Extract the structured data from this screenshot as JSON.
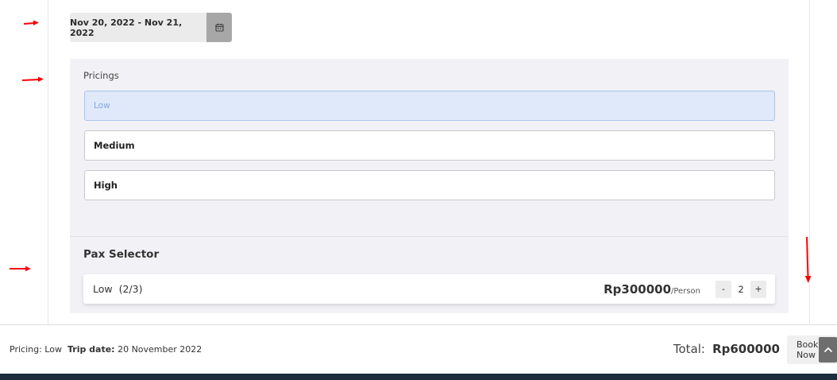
{
  "date_range": {
    "text": "Nov 20, 2022 - Nov 21, 2022",
    "icon": "calendar-icon"
  },
  "pricings": {
    "label": "Pricings",
    "options": [
      {
        "label": "Low",
        "selected": true
      },
      {
        "label": "Medium",
        "selected": false
      },
      {
        "label": "High",
        "selected": false
      }
    ]
  },
  "pax": {
    "title": "Pax Selector",
    "row": {
      "name": "Low",
      "count": "(2/3)",
      "price": "Rp300000",
      "unit": "/Person",
      "minus": "-",
      "value": "2",
      "plus": "+"
    }
  },
  "footer": {
    "pricing_label": "Pricing:",
    "pricing_value": "Low",
    "trip_label": "Trip date:",
    "trip_value": "20 November 2022",
    "total_label": "Total:",
    "total_value": "Rp600000",
    "book_label": "Book Now"
  },
  "colors": {
    "selected_bg": "#dfe9f9",
    "selected_text": "#84a8e3",
    "annotation_arrow": "#ff0000"
  }
}
